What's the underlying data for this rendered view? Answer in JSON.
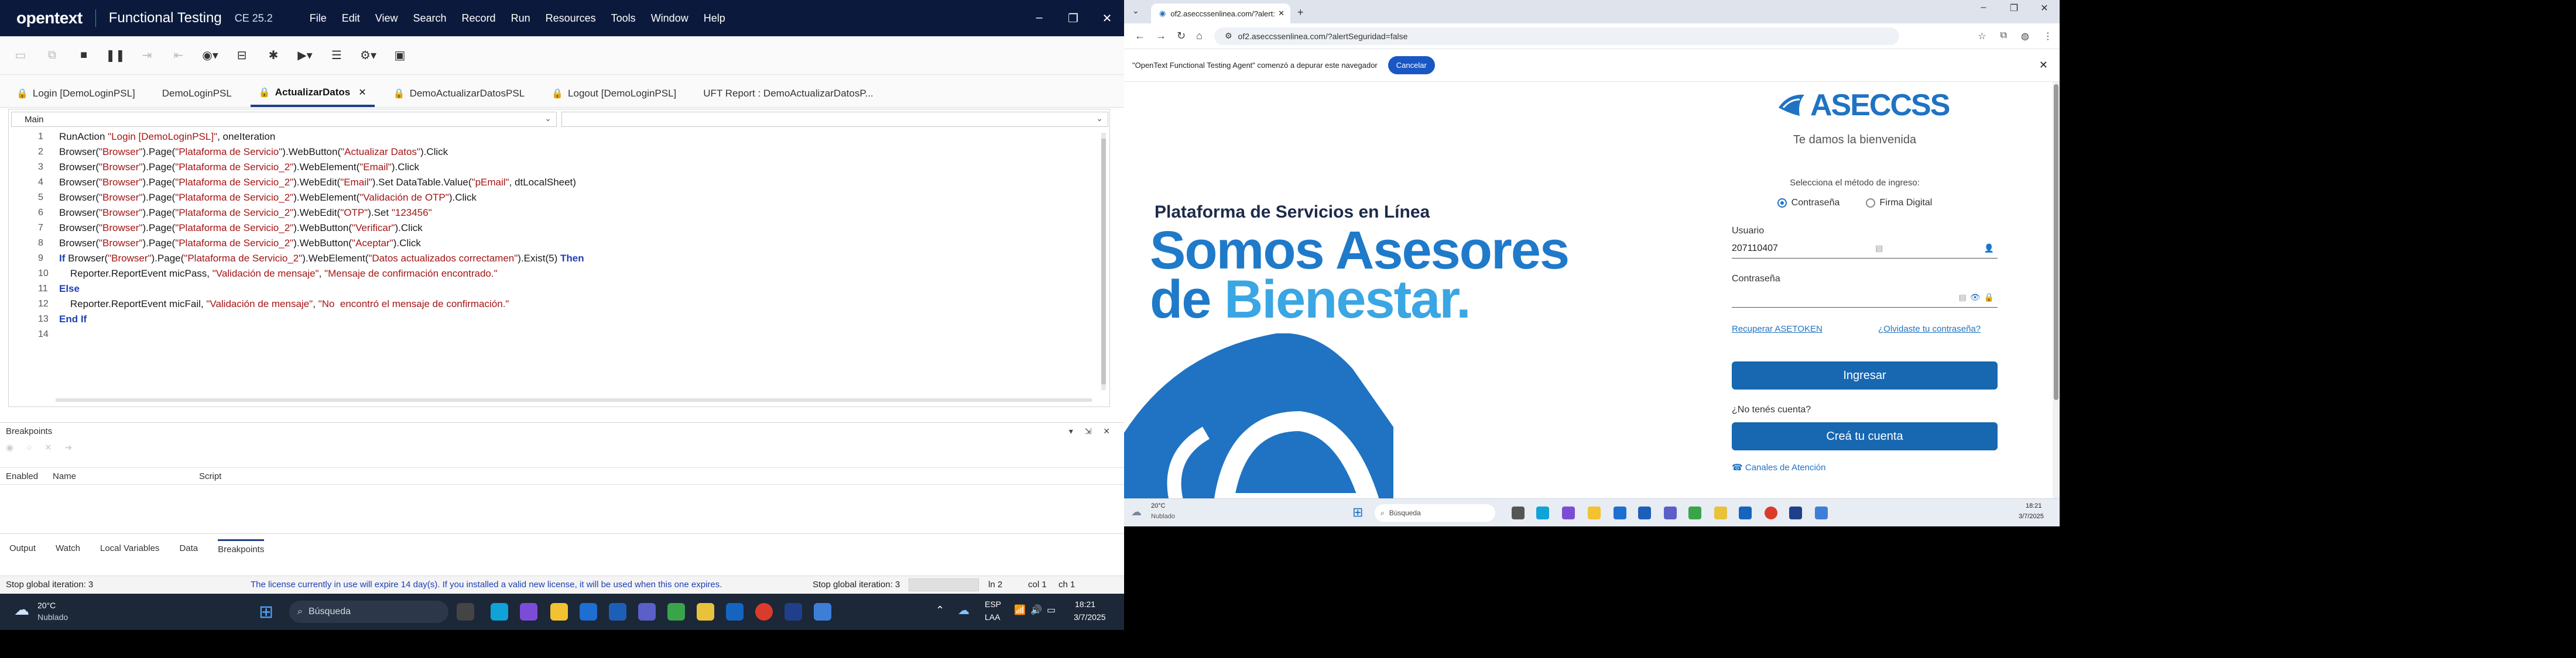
{
  "uft": {
    "brand": "opentext",
    "product": "Functional Testing",
    "version": "CE 25.2",
    "menu": [
      "File",
      "Edit",
      "View",
      "Search",
      "Record",
      "Run",
      "Resources",
      "Tools",
      "Window",
      "Help"
    ],
    "tabs": [
      {
        "label": "Login [DemoLoginPSL]",
        "locked": true
      },
      {
        "label": "DemoLoginPSL",
        "locked": false
      },
      {
        "label": "ActualizarDatos",
        "locked": true,
        "active": true
      },
      {
        "label": "DemoActualizarDatosPSL",
        "locked": true
      },
      {
        "label": "Logout [DemoLoginPSL]",
        "locked": true
      },
      {
        "label": "UFT Report : DemoActualizarDatosP...",
        "locked": false
      }
    ],
    "combo_left": "Main",
    "code_lines": [
      "RunAction \"Login [DemoLoginPSL]\", oneIteration",
      "Browser(\"Browser\").Page(\"Plataforma de Servicio\").WebButton(\"Actualizar Datos\").Click",
      "Browser(\"Browser\").Page(\"Plataforma de Servicio_2\").WebElement(\"Email\").Click",
      "Browser(\"Browser\").Page(\"Plataforma de Servicio_2\").WebEdit(\"Email\").Set DataTable.Value(\"pEmail\", dtLocalSheet)",
      "Browser(\"Browser\").Page(\"Plataforma de Servicio_2\").WebElement(\"Validación de OTP\").Click",
      "Browser(\"Browser\").Page(\"Plataforma de Servicio_2\").WebEdit(\"OTP\").Set \"123456\"",
      "Browser(\"Browser\").Page(\"Plataforma de Servicio_2\").WebButton(\"Verificar\").Click",
      "Browser(\"Browser\").Page(\"Plataforma de Servicio_2\").WebButton(\"Aceptar\").Click",
      "If Browser(\"Browser\").Page(\"Plataforma de Servicio_2\").WebElement(\"Datos actualizados correctamen\").Exist(5) Then",
      "    Reporter.ReportEvent micPass, \"Validación de mensaje\", \"Mensaje de confirmación encontrado.\"",
      "Else",
      "    Reporter.ReportEvent micFail, \"Validación de mensaje\", \"No  encontró el mensaje de confirmación.\"",
      "End If",
      ""
    ],
    "breakpoints": {
      "title": "Breakpoints",
      "columns": [
        "Enabled",
        "Name",
        "Script"
      ]
    },
    "bottom_tabs": [
      "Output",
      "Watch",
      "Local Variables",
      "Data",
      "Breakpoints"
    ],
    "bottom_active": "Breakpoints",
    "status": {
      "left": "Stop global iteration: 3",
      "license": "The license currently in use will expire 14 day(s). If you installed a valid new license, it will be used when this one expires.",
      "right": "Stop global iteration: 3",
      "ln": "ln 2",
      "col": "col 1",
      "ch": "ch 1"
    },
    "taskbar": {
      "weather_temp": "20°C",
      "weather_desc": "Nublado",
      "search_placeholder": "Búsqueda",
      "lang": "ESP",
      "lang2": "LAA",
      "time": "18:21",
      "date": "3/7/2025"
    }
  },
  "browser": {
    "tab_title": "of2.aseccssenlinea.com/?alert:",
    "url": "of2.aseccssenlinea.com/?alertSeguridad=false",
    "infobar_message": "\"OpenText Functional Testing Agent\" comenzó a depurar este navegador",
    "infobar_button": "Cancelar",
    "hero_tag": "Plataforma de Servicios en Línea",
    "hero_line1": "Somos Asesores",
    "hero_line2a": "de ",
    "hero_line2b": "Bienestar.",
    "login": {
      "logo": "ASECCSS",
      "welcome": "Te damos la bienvenida",
      "method_prompt": "Selecciona el método de ingreso:",
      "option_password": "Contraseña",
      "option_signature": "Firma Digital",
      "user_label": "Usuario",
      "user_value": "207110407",
      "password_label": "Contraseña",
      "recover_link": "Recuperar ASETOKEN",
      "forgot_link": "¿Olvidaste tu contraseña?",
      "login_button": "Ingresar",
      "no_account": "¿No tenés cuenta?",
      "create_button": "Creá tu cuenta",
      "channels_link": "Canales de Atención"
    },
    "taskbar": {
      "weather_temp": "20°C",
      "weather_desc": "Nublado",
      "search_placeholder": "Búsqueda",
      "time": "18:21",
      "date": "3/7/2025"
    }
  },
  "colors": {
    "uft_title": "#0b1a3c",
    "aseccss_blue": "#1f73c2",
    "button_blue": "#1767b1",
    "taskbar": "#1c2737"
  }
}
